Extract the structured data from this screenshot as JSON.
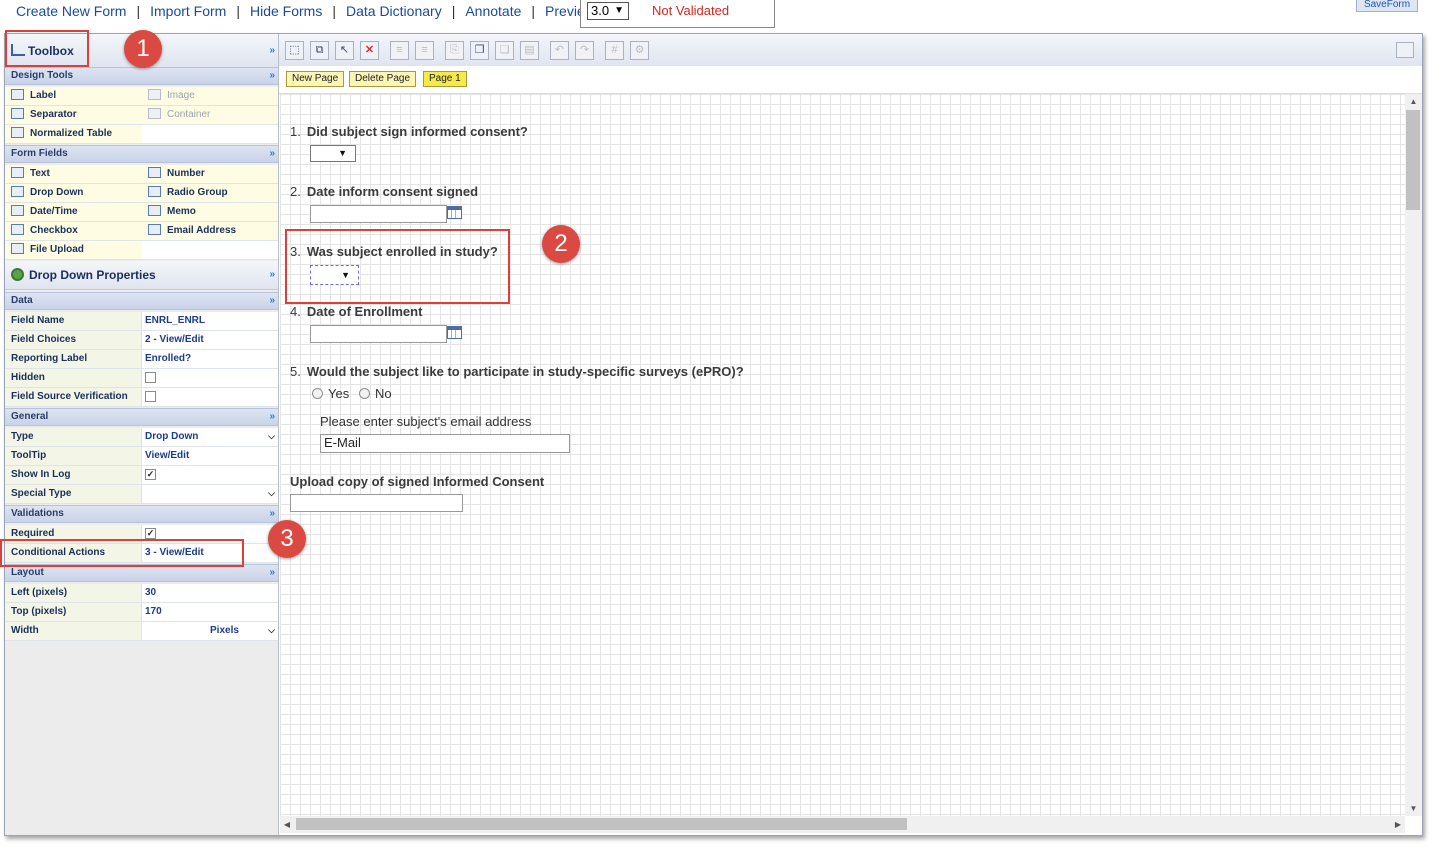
{
  "nav": {
    "links": [
      "Create New Form",
      "Import Form",
      "Hide Forms",
      "Data Dictionary",
      "Annotate",
      "Preview"
    ],
    "separator": "|"
  },
  "version": {
    "value": "3.0",
    "arrow": "▼"
  },
  "status": "Not Validated",
  "save_button": "SaveForm",
  "toolbox": {
    "title": "Toolbox",
    "collapse_glyph": "»",
    "design_tools": {
      "title": "Design Tools",
      "items": [
        [
          "Label",
          "Image"
        ],
        [
          "Separator",
          "Container"
        ],
        [
          "Normalized Table",
          ""
        ]
      ]
    },
    "form_fields": {
      "title": "Form Fields",
      "items": [
        [
          "Text",
          "Number"
        ],
        [
          "Drop Down",
          "Radio Group"
        ],
        [
          "Date/Time",
          "Memo"
        ],
        [
          "Checkbox",
          "Email Address"
        ],
        [
          "File Upload",
          ""
        ]
      ]
    }
  },
  "properties": {
    "title": "Drop Down Properties",
    "data": {
      "title": "Data",
      "rows": [
        {
          "label": "Field Name",
          "value": "ENRL_ENRL"
        },
        {
          "label": "Field Choices",
          "value": "2 - View/Edit"
        },
        {
          "label": "Reporting Label",
          "value": "Enrolled?"
        },
        {
          "label": "Hidden",
          "value": ""
        },
        {
          "label": "Field Source Verification",
          "value": ""
        }
      ]
    },
    "general": {
      "title": "General",
      "rows": [
        {
          "label": "Type",
          "value": "Drop Down"
        },
        {
          "label": "ToolTip",
          "value": "View/Edit"
        },
        {
          "label": "Show In Log",
          "value": "✓"
        },
        {
          "label": "Special Type",
          "value": ""
        }
      ]
    },
    "validations": {
      "title": "Validations",
      "rows": [
        {
          "label": "Required",
          "value": "✓"
        },
        {
          "label": "Conditional Actions",
          "value": "3 - View/Edit"
        }
      ]
    },
    "layout": {
      "title": "Layout",
      "rows": [
        {
          "label": "Left (pixels)",
          "value": "30"
        },
        {
          "label": "Top (pixels)",
          "value": "170"
        },
        {
          "label": "Width",
          "value": "",
          "unit": "Pixels"
        }
      ]
    }
  },
  "toolbar": {
    "icons": [
      "select-all-icon",
      "copy-layout-icon",
      "pointer-icon",
      "delete-icon",
      "align-left-icon",
      "align-right-icon",
      "paste-icon",
      "copy-icon",
      "duplicate-icon",
      "open-folder-icon",
      "undo-icon",
      "redo-icon",
      "grid-icon",
      "settings-icon"
    ],
    "glyphs": [
      "⬚",
      "⧉",
      "↖",
      "✕",
      "≡",
      "≡",
      "⎘",
      "❐",
      "❏",
      "▤",
      "↶",
      "↷",
      "#",
      "⚙"
    ]
  },
  "pages": {
    "new_page": "New Page",
    "delete_page": "Delete Page",
    "current": "Page 1"
  },
  "form": {
    "questions": [
      {
        "num": "1.",
        "text": "Did subject sign informed consent?"
      },
      {
        "num": "2.",
        "text": "Date inform consent signed"
      },
      {
        "num": "3.",
        "text": "Was subject enrolled in study?"
      },
      {
        "num": "4.",
        "text": "Date of Enrollment"
      },
      {
        "num": "5.",
        "text": "Would the subject like to participate in study-specific surveys (ePRO)?"
      }
    ],
    "radio_yes": "Yes",
    "radio_no": "No",
    "email_prompt": "Please enter subject's email address",
    "email_value": "E-Mail",
    "upload_label": "Upload copy of signed Informed Consent",
    "dropdown_arrow": "▼"
  },
  "callouts": [
    "1",
    "2",
    "3"
  ],
  "colors": {
    "accent_red": "#d9413a",
    "link_blue": "#1a4a9c",
    "status_red": "#d0281f",
    "page_tab_yellow": "#fbf6b6"
  }
}
